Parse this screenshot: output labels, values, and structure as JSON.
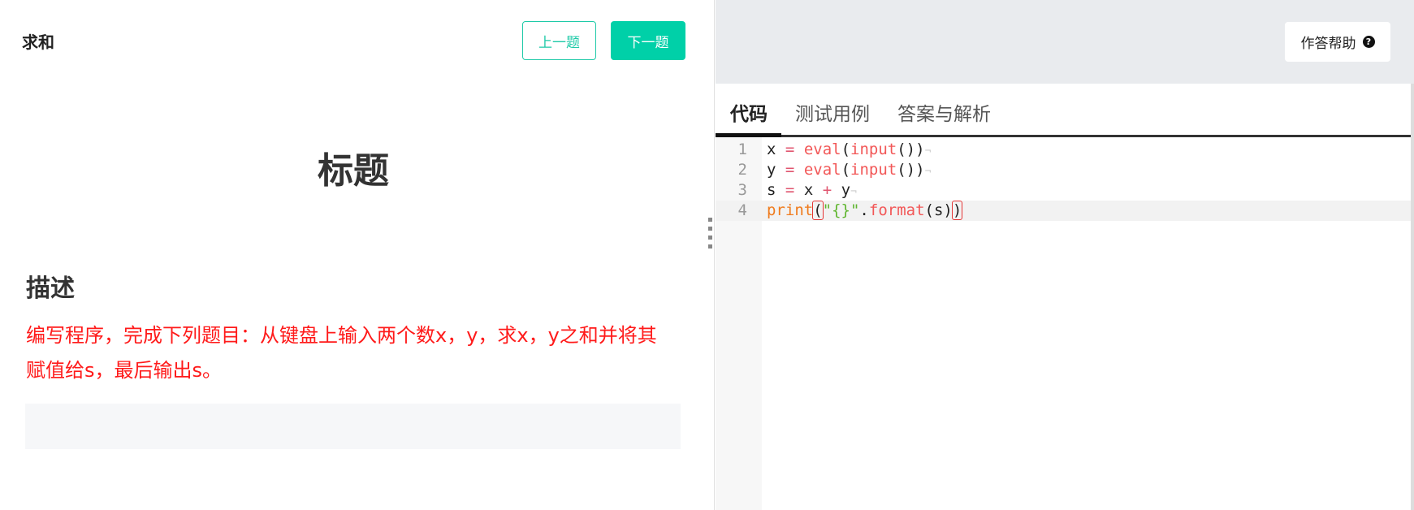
{
  "problem": {
    "name": "求和",
    "prev_label": "上一题",
    "next_label": "下一题",
    "title": "标题",
    "section_heading": "描述",
    "description": "编写程序，完成下列题目：从键盘上输入两个数x，y，求x，y之和并将其赋值给s，最后输出s。"
  },
  "right": {
    "help_label": "作答帮助",
    "help_icon": "question-circle-icon",
    "tabs": [
      {
        "label": "代码",
        "active": true
      },
      {
        "label": "测试用例",
        "active": false
      },
      {
        "label": "答案与解析",
        "active": false
      }
    ]
  },
  "editor": {
    "line_numbers": [
      "1",
      "2",
      "3",
      "4"
    ],
    "active_line": 4,
    "lines": [
      "x = eval(input())",
      "y = eval(input())",
      "s = x + y",
      "print(\"{}\".format(s))"
    ],
    "tokens": {
      "l1": {
        "var": "x",
        "op": "=",
        "fn1": "eval",
        "p1": "(",
        "fn2": "input",
        "p2": "())",
        "eol": "¬"
      },
      "l2": {
        "var": "y",
        "op": "=",
        "fn1": "eval",
        "p1": "(",
        "fn2": "input",
        "p2": "())",
        "eol": "¬"
      },
      "l3": {
        "var": "s",
        "op": "=",
        "a": "x",
        "plus": "+",
        "b": "y",
        "eol": "¬"
      },
      "l4": {
        "kw": "print",
        "open": "(",
        "str": "\"{}\"",
        "dot": ".",
        "fn": "format",
        "arg": "(s)",
        "close": ")"
      }
    }
  },
  "colors": {
    "accent": "#00d0a8",
    "description_text": "#ff1a1a",
    "header_bg": "#e9ebee"
  }
}
